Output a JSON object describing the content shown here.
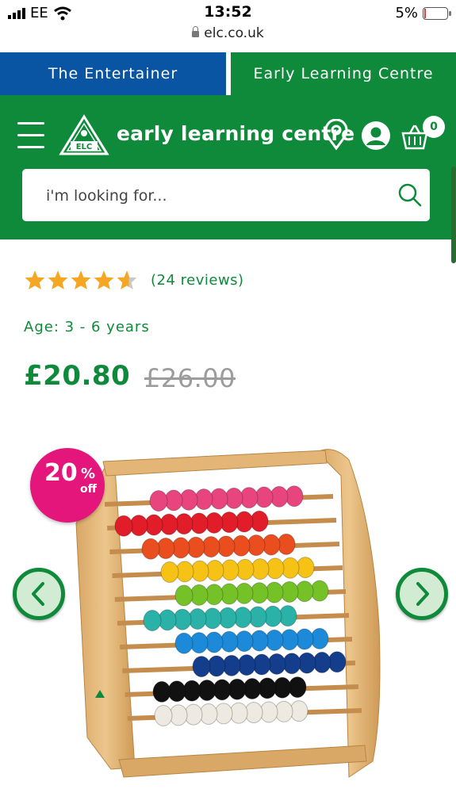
{
  "status_bar": {
    "carrier": "EE",
    "time": "13:52",
    "battery": "5%",
    "url": "elc.co.uk"
  },
  "store_tabs": [
    {
      "label": "The Entertainer"
    },
    {
      "label": "Early Learning Centre"
    }
  ],
  "header": {
    "brand": "early learning centre",
    "logo_text": "ELC",
    "basket_count": "0",
    "search_placeholder": "i'm looking for..."
  },
  "product": {
    "rating": 4.5,
    "rating_max": 5,
    "reviews": "(24 reviews)",
    "age": "Age: 3 - 6 years",
    "price": "£20.80",
    "was_price": "£26.00"
  },
  "badge": {
    "percent": "20",
    "symbol": "%",
    "off": "off"
  },
  "abacus_rows": [
    "#e8457f",
    "#e11d2a",
    "#ea4e1f",
    "#f6c215",
    "#74c227",
    "#2ab2a8",
    "#1c8ad8",
    "#143d8c",
    "#111111",
    "#eeeae2"
  ],
  "colors": {
    "brand_green": "#0e8a3a",
    "entertainer_blue": "#0a55a3",
    "sale_pink": "#e4157b",
    "star": "#f5a623"
  },
  "icons": [
    "menu-icon",
    "location-pin-icon",
    "account-icon",
    "basket-icon",
    "search-icon",
    "chevron-left-icon",
    "chevron-right-icon",
    "star-icon"
  ]
}
